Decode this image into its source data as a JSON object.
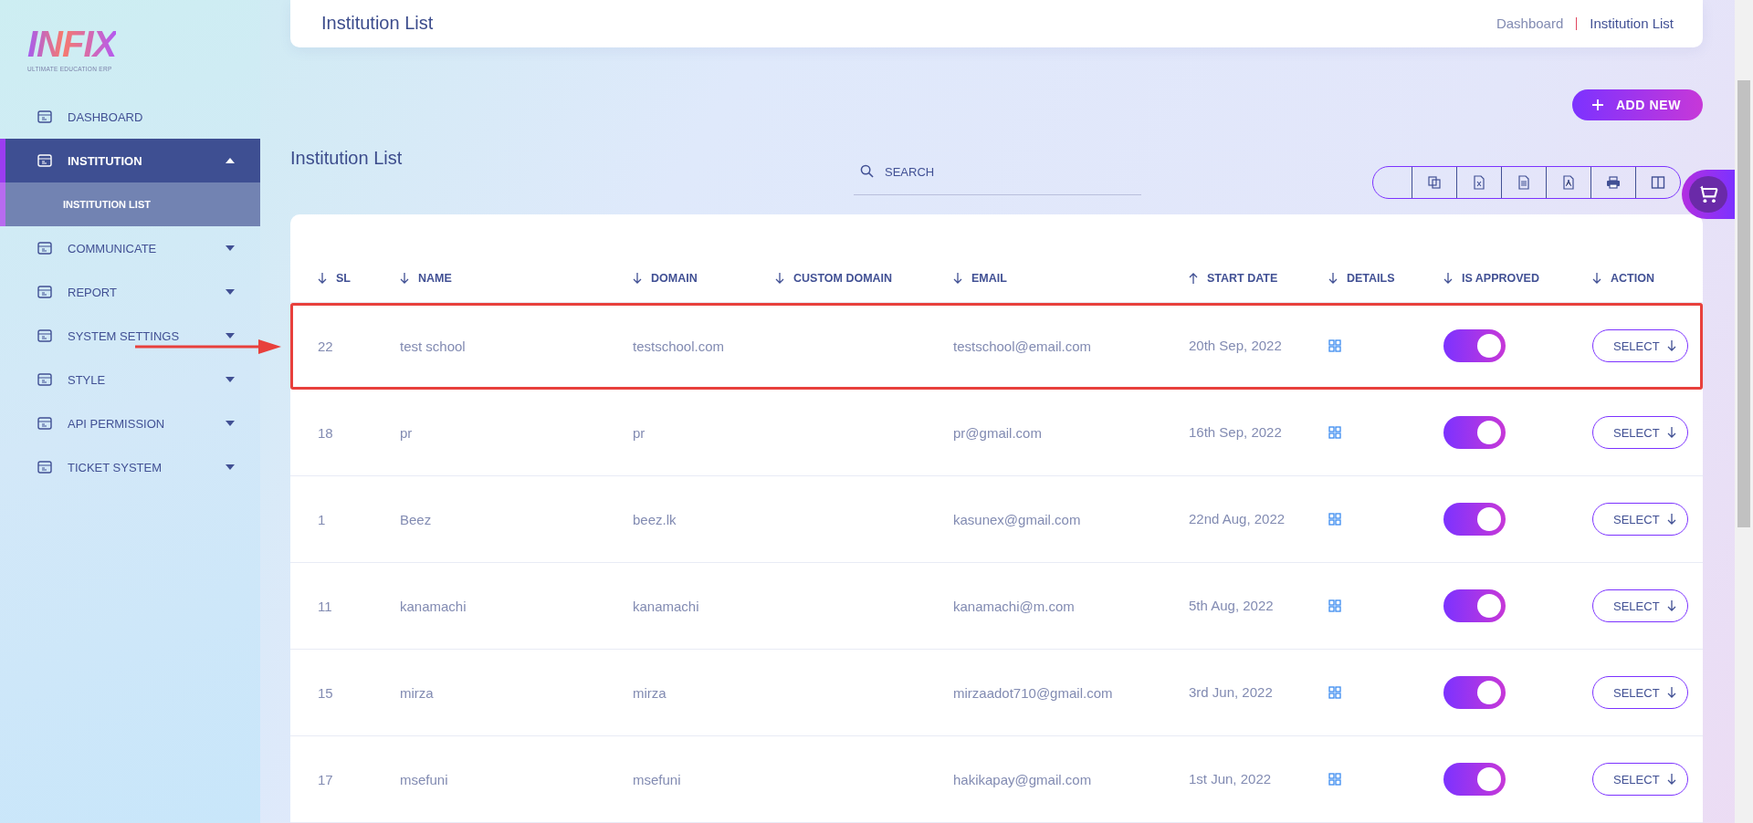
{
  "logo": {
    "name": "INFIX",
    "tagline": "ULTIMATE EDUCATION ERP"
  },
  "sidebar": {
    "items": [
      {
        "label": "DASHBOARD",
        "selected": false
      },
      {
        "label": "INSTITUTION",
        "selected": true,
        "expanded": true,
        "children": [
          {
            "label": "INSTITUTION LIST",
            "selected": true
          }
        ]
      },
      {
        "label": "COMMUNICATE",
        "selected": false,
        "expanded": false
      },
      {
        "label": "REPORT",
        "selected": false,
        "expanded": false
      },
      {
        "label": "SYSTEM SETTINGS",
        "selected": false,
        "expanded": false
      },
      {
        "label": "STYLE",
        "selected": false,
        "expanded": false
      },
      {
        "label": "API PERMISSION",
        "selected": false,
        "expanded": false
      },
      {
        "label": "TICKET SYSTEM",
        "selected": false,
        "expanded": false
      }
    ]
  },
  "header": {
    "title": "Institution List",
    "breadcrumb": [
      "Dashboard",
      "Institution List"
    ]
  },
  "add_button": "ADD NEW",
  "section_title": "Institution List",
  "search": {
    "placeholder": "SEARCH"
  },
  "table": {
    "columns": [
      {
        "label": "SL",
        "sort_ascending": false
      },
      {
        "label": "NAME",
        "sort_ascending": false
      },
      {
        "label": "DOMAIN",
        "sort_ascending": false
      },
      {
        "label": "CUSTOM DOMAIN",
        "sort_ascending": false
      },
      {
        "label": "EMAIL",
        "sort_ascending": false
      },
      {
        "label": "START DATE",
        "sort_ascending": true
      },
      {
        "label": "DETAILS",
        "sort_ascending": false
      },
      {
        "label": "IS APPROVED",
        "sort_ascending": false
      },
      {
        "label": "ACTION",
        "sort_ascending": false
      }
    ],
    "rows": [
      {
        "sl": "22",
        "name": "test school",
        "domain": "testschool.com",
        "email": "testschool@email.com",
        "start_date": "20th Sep, 2022",
        "approved": true,
        "action": "SELECT",
        "highlighted": true
      },
      {
        "sl": "18",
        "name": "pr",
        "domain": "pr",
        "email": "pr@gmail.com",
        "start_date": "16th Sep, 2022",
        "approved": true,
        "action": "SELECT",
        "highlighted": false
      },
      {
        "sl": "1",
        "name": "Beez",
        "domain": "beez.lk",
        "email": "kasunex@gmail.com",
        "start_date": "22nd Aug, 2022",
        "approved": true,
        "action": "SELECT",
        "highlighted": false
      },
      {
        "sl": "11",
        "name": "kanamachi",
        "domain": "kanamachi",
        "email": "kanamachi@m.com",
        "start_date": "5th Aug, 2022",
        "approved": true,
        "action": "SELECT",
        "highlighted": false
      },
      {
        "sl": "15",
        "name": "mirza",
        "domain": "mirza",
        "email": "mirzaadot710@gmail.com",
        "start_date": "3rd Jun, 2022",
        "approved": true,
        "action": "SELECT",
        "highlighted": false
      },
      {
        "sl": "17",
        "name": "msefuni",
        "domain": "msefuni",
        "email": "hakikapay@gmail.com",
        "start_date": "1st Jun, 2022",
        "approved": true,
        "action": "SELECT",
        "highlighted": false
      }
    ]
  }
}
